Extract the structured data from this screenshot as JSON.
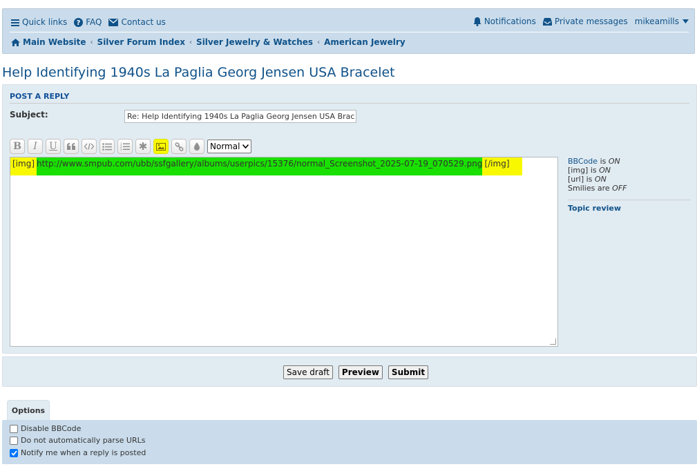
{
  "nav": {
    "quick_links": "Quick links",
    "faq": "FAQ",
    "contact": "Contact us",
    "notifications": "Notifications",
    "private_messages": "Private messages",
    "username": "mikeamills"
  },
  "breadcrumbs": [
    "Main Website",
    "Silver Forum Index",
    "Silver Jewelry & Watches",
    "American Jewelry"
  ],
  "page_title": "Help Identifying 1940s La Paglia Georg Jensen USA Bracelet",
  "form": {
    "heading": "Post a reply",
    "subject_label": "Subject:",
    "subject_value": "Re: Help Identifying 1940s La Paglia Georg Jensen USA Brac",
    "font_size_value": "Normal",
    "editor_open_tag": "[img]",
    "editor_url": "http://www.smpub.com/ubb/ssfgallery/albums/userpics/15376/normal_Screenshot_2025-07-19_070529.png",
    "editor_close_tag": "[/img]"
  },
  "toolbar_icons": [
    "bold-icon",
    "italic-icon",
    "underline-icon",
    "quote-icon",
    "code-icon",
    "list-icon",
    "numbered-list-icon",
    "asterisk-icon",
    "image-icon",
    "link-icon",
    "color-icon"
  ],
  "status": {
    "bbcode_label": "BBCode",
    "bbcode_is": "is",
    "bbcode_state": "ON",
    "img_label": "[img] is",
    "img_state": "ON",
    "url_label": "[url] is",
    "url_state": "ON",
    "smilies_label": "Smilies are",
    "smilies_state": "OFF",
    "topic_review": "Topic review"
  },
  "buttons": {
    "save_draft": "Save draft",
    "preview": "Preview",
    "submit": "Submit"
  },
  "options": {
    "tab_label": "Options",
    "disable_bbcode": "Disable BBCode",
    "no_parse_urls": "Do not automatically parse URLs",
    "notify": "Notify me when a reply is posted"
  },
  "colors": {
    "link": "#105289",
    "highlight_yellow": "#f8f800",
    "highlight_green": "#19e000",
    "panel_bg": "#e1ebf2",
    "nav_bg": "#cadceb"
  }
}
